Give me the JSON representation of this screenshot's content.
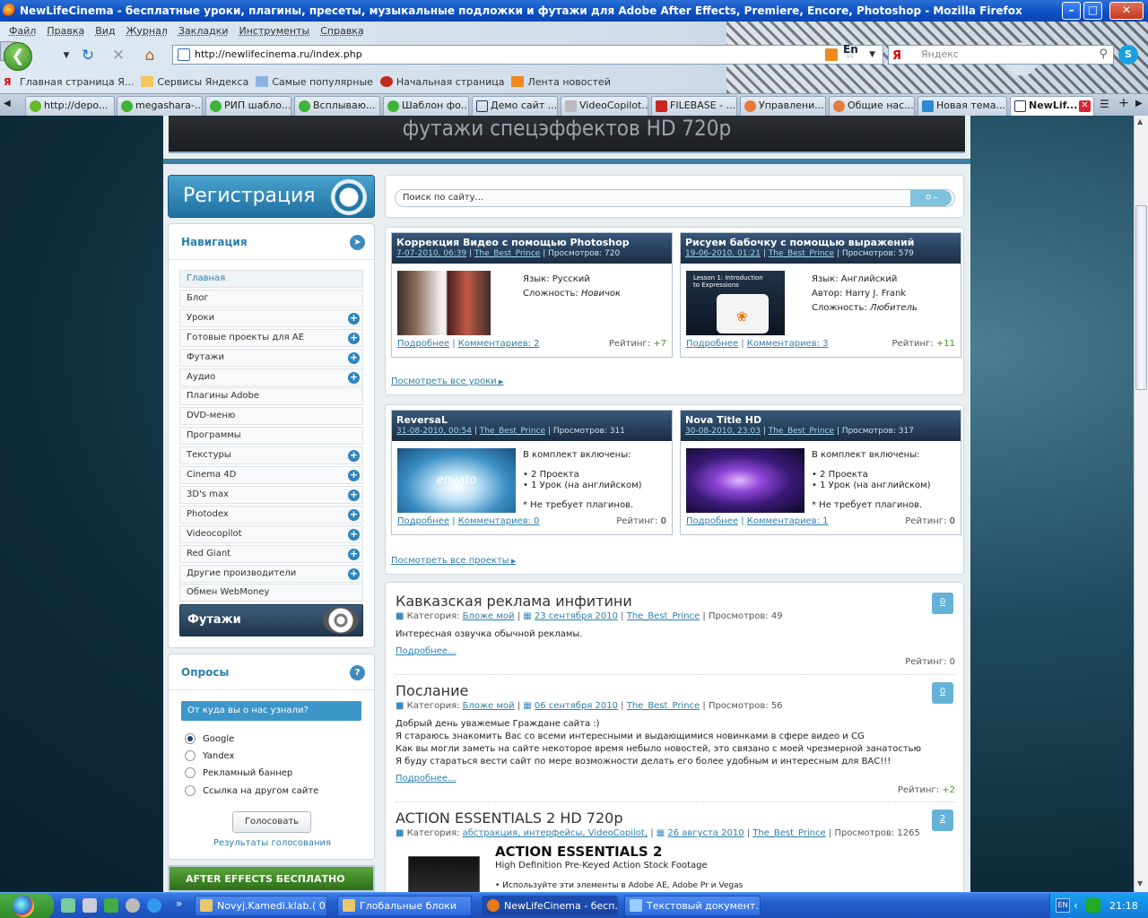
{
  "window": {
    "title": "NewLifeCinema - бесплатные уроки, плагины, пресеты, музыкальные подложки и футажи для Adobe After Effects, Premiere, Encore, Photoshop - Mozilla Firefox"
  },
  "menu": [
    "Файл",
    "Правка",
    "Вид",
    "Журнал",
    "Закладки",
    "Инструменты",
    "Справка"
  ],
  "url": "http://newlifecinema.ru/index.php",
  "lang": "En",
  "browser_search_placeholder": "Яндекс",
  "bookmarks": [
    "Главная страница Я...",
    "Сервисы Яндекса",
    "Самые популярные",
    "Начальная страница",
    "Лента новостей"
  ],
  "tabs": [
    "http://depo...",
    "megashara-...",
    "РИП шабло...",
    "Всплываю...",
    "Шаблон фо...",
    "Демо сайт ...",
    "VideoCopilot...",
    "FILEBASE - ...",
    "Управлени...",
    "Общие нас...",
    "Новая тема...",
    "NewLif..."
  ],
  "site": {
    "banner_text": "футажи спецэффектов  HD 720p",
    "register": "Регистрация",
    "search_placeholder": "Поиск по сайту...",
    "nav_title": "Навигация",
    "nav": [
      {
        "label": "Главная",
        "plus": false
      },
      {
        "label": "Блог",
        "plus": false
      },
      {
        "label": "Уроки",
        "plus": true
      },
      {
        "label": "Готовые проекты для AE",
        "plus": true
      },
      {
        "label": "Футажи",
        "plus": true
      },
      {
        "label": "Аудио",
        "plus": true
      },
      {
        "label": "Плагины Adobe",
        "plus": false
      },
      {
        "label": "DVD-меню",
        "plus": false
      },
      {
        "label": "Программы",
        "plus": false
      },
      {
        "label": "Текстуры",
        "plus": true
      },
      {
        "label": "Cinema 4D",
        "plus": true
      },
      {
        "label": "3D's max",
        "plus": true
      },
      {
        "label": "Photodex",
        "plus": true
      },
      {
        "label": "Videocopilot",
        "plus": true
      },
      {
        "label": "Red Giant",
        "plus": true
      },
      {
        "label": "Другие производители",
        "plus": true
      },
      {
        "label": "Обмен WebMoney",
        "plus": false
      }
    ],
    "footazhi_label": "Футажи",
    "poll": {
      "title": "Опросы",
      "question": "От куда вы о нас узнали?",
      "options": [
        "Google",
        "Yandex",
        "Рекламный баннер",
        "Ссылка на другом сайте"
      ],
      "selected": 0,
      "vote": "Голосовать",
      "results": "Результаты голосования"
    },
    "ae_banner": "AFTER EFFECTS     БЕСПЛАТНО",
    "lessons": [
      {
        "title": "Коррекция Видео с помощью Photoshop",
        "date": "7-07-2010, 06:39",
        "author": "The_Best_Prince",
        "views": "Просмотров: 720",
        "info": [
          [
            "Язык:",
            "Русский"
          ],
          [
            "Сложность:",
            "Новичок"
          ]
        ],
        "comments": "Комментариев: 2",
        "rating": "+7"
      },
      {
        "title": "Рисуем бабочку с помощью выражений",
        "date": "19-06-2010, 01:21",
        "author": "The_Best_Prince",
        "views": "Просмотров: 579",
        "info": [
          [
            "Язык:",
            "Английский"
          ],
          [
            "Автор:",
            "Harry J. Frank"
          ],
          [
            "Сложность:",
            "Любитель"
          ]
        ],
        "comments": "Комментариев: 3",
        "rating": "+11",
        "thumb_text": "Lesson 1: Introduction to Expressions"
      }
    ],
    "view_all_lessons": "Посмотреть все уроки",
    "projects": [
      {
        "title": "ReversaL",
        "date": "31-08-2010, 00:54",
        "author": "The_Best_Prince",
        "views": "Просмотров: 311",
        "head": "В комплект включены:",
        "items": [
          "2 Проекта",
          "1 Урок (на английском)"
        ],
        "note": "* Не требует плагинов.",
        "comments": "Комментариев: 0",
        "rating": "0",
        "thumb_text": "envato"
      },
      {
        "title": "Nova Title HD",
        "date": "30-08-2010, 23:03",
        "author": "The_Best_Prince",
        "views": "Просмотров: 317",
        "head": "В комплект включены:",
        "items": [
          "2 Проекта",
          "1 Урок (на английском)"
        ],
        "note": "* Не требует плагинов.",
        "comments": "Комментариев: 1",
        "rating": "0"
      }
    ],
    "view_all_projects": "Посмотреть все проекты",
    "more": "Подробнее",
    "more_dots": "Подробнее...",
    "rating_label": "Рейтинг:",
    "category_label": "Категория:",
    "news": [
      {
        "title": "Кавказская реклама инфитини",
        "cat": "Бложе мой",
        "date": "23 сентября 2010",
        "author": "The_Best_Prince",
        "views": "Просмотров: 49",
        "text": [
          "Интересная озвучка обычной рекламы."
        ],
        "rating": "0",
        "comments": "0"
      },
      {
        "title": "Послание",
        "cat": "Бложе мой",
        "date": "06 сентября 2010",
        "author": "The_Best_Prince",
        "views": "Просмотров: 56",
        "text": [
          "Добрый день уважемые Граждане сайта :)",
          "Я стараюсь знакомить Вас со всеми интересными и выдающимися новинками в сфере видео и CG",
          "Как вы могли заметь на сайте некоторое время небыло новостей, это связано с моей чрезмерной занатостью",
          "Я буду стараться вести сайт по мере возможности делать его более удобным и интересным для ВАС!!!"
        ],
        "rating": "+2",
        "comments": "0"
      },
      {
        "title": "ACTION ESSENTIALS 2 HD 720p",
        "cat": "абстракция, интерфейсы, VideoCopilot,",
        "date": "26 августа 2010",
        "author": "The_Best_Prince",
        "views": "Просмотров: 1265",
        "comments": "2",
        "promo_title": "ACTION ESSENTIALS 2",
        "promo_sub": "High Definition Pre-Keyed Action Stock Footage",
        "promo_bullet": "Используйте эти элементы в Adobe AE, Adobe Pr и Vegas"
      }
    ]
  },
  "taskbar": {
    "items": [
      "Novyj.Kamedi.klab.( 0...",
      "Глобальные блоки",
      "NewLifeCinema - бесп...",
      "Текстовый документ..."
    ],
    "lang": "EN",
    "time": "21:18"
  }
}
